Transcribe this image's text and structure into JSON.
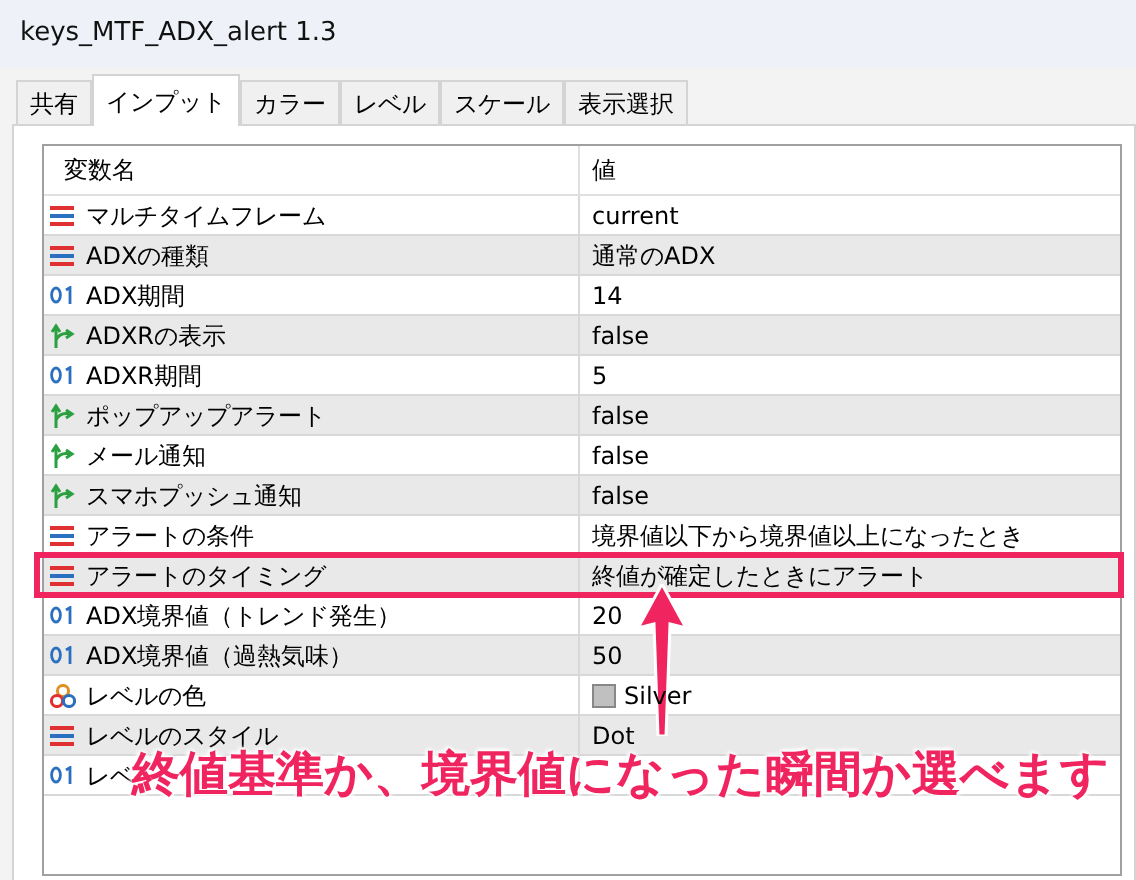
{
  "window": {
    "title": "keys_MTF_ADX_alert 1.3"
  },
  "tabs": [
    {
      "label": "共有",
      "selected": false
    },
    {
      "label": "インプット",
      "selected": true
    },
    {
      "label": "カラー",
      "selected": false
    },
    {
      "label": "レベル",
      "selected": false
    },
    {
      "label": "スケール",
      "selected": false
    },
    {
      "label": "表示選択",
      "selected": false
    }
  ],
  "table": {
    "columns": [
      "変数名",
      "値"
    ],
    "rows": [
      {
        "kind": "enum",
        "name": "マルチタイムフレーム",
        "value": "current",
        "highlighted": false
      },
      {
        "kind": "enum",
        "name": "ADXの種類",
        "value": "通常のADX",
        "highlighted": false
      },
      {
        "kind": "int",
        "name": "ADX期間",
        "value": "14",
        "highlighted": false
      },
      {
        "kind": "bool",
        "name": "ADXRの表示",
        "value": "false",
        "highlighted": false
      },
      {
        "kind": "int",
        "name": "ADXR期間",
        "value": "5",
        "highlighted": false
      },
      {
        "kind": "bool",
        "name": "ポップアップアラート",
        "value": "false",
        "highlighted": false
      },
      {
        "kind": "bool",
        "name": "メール通知",
        "value": "false",
        "highlighted": false
      },
      {
        "kind": "bool",
        "name": "スマホプッシュ通知",
        "value": "false",
        "highlighted": false
      },
      {
        "kind": "enum",
        "name": "アラートの条件",
        "value": "境界値以下から境界値以上になったとき",
        "highlighted": false
      },
      {
        "kind": "enum",
        "name": "アラートのタイミング",
        "value": "終値が確定したときにアラート",
        "highlighted": true
      },
      {
        "kind": "int",
        "name": "ADX境界値（トレンド発生）",
        "value": "20",
        "highlighted": false
      },
      {
        "kind": "int",
        "name": "ADX境界値（過熱気味）",
        "value": "50",
        "highlighted": false
      },
      {
        "kind": "color",
        "name": "レベルの色",
        "value": "Silver",
        "color": "#c0c0c0",
        "highlighted": false
      },
      {
        "kind": "enum",
        "name": "レベルのスタイル",
        "value": "Dot",
        "highlighted": false
      },
      {
        "kind": "int",
        "name": "レベ",
        "highlighted": false
      }
    ]
  },
  "annotation": {
    "text": "終値基準か、境界値になった瞬間か選べます"
  }
}
